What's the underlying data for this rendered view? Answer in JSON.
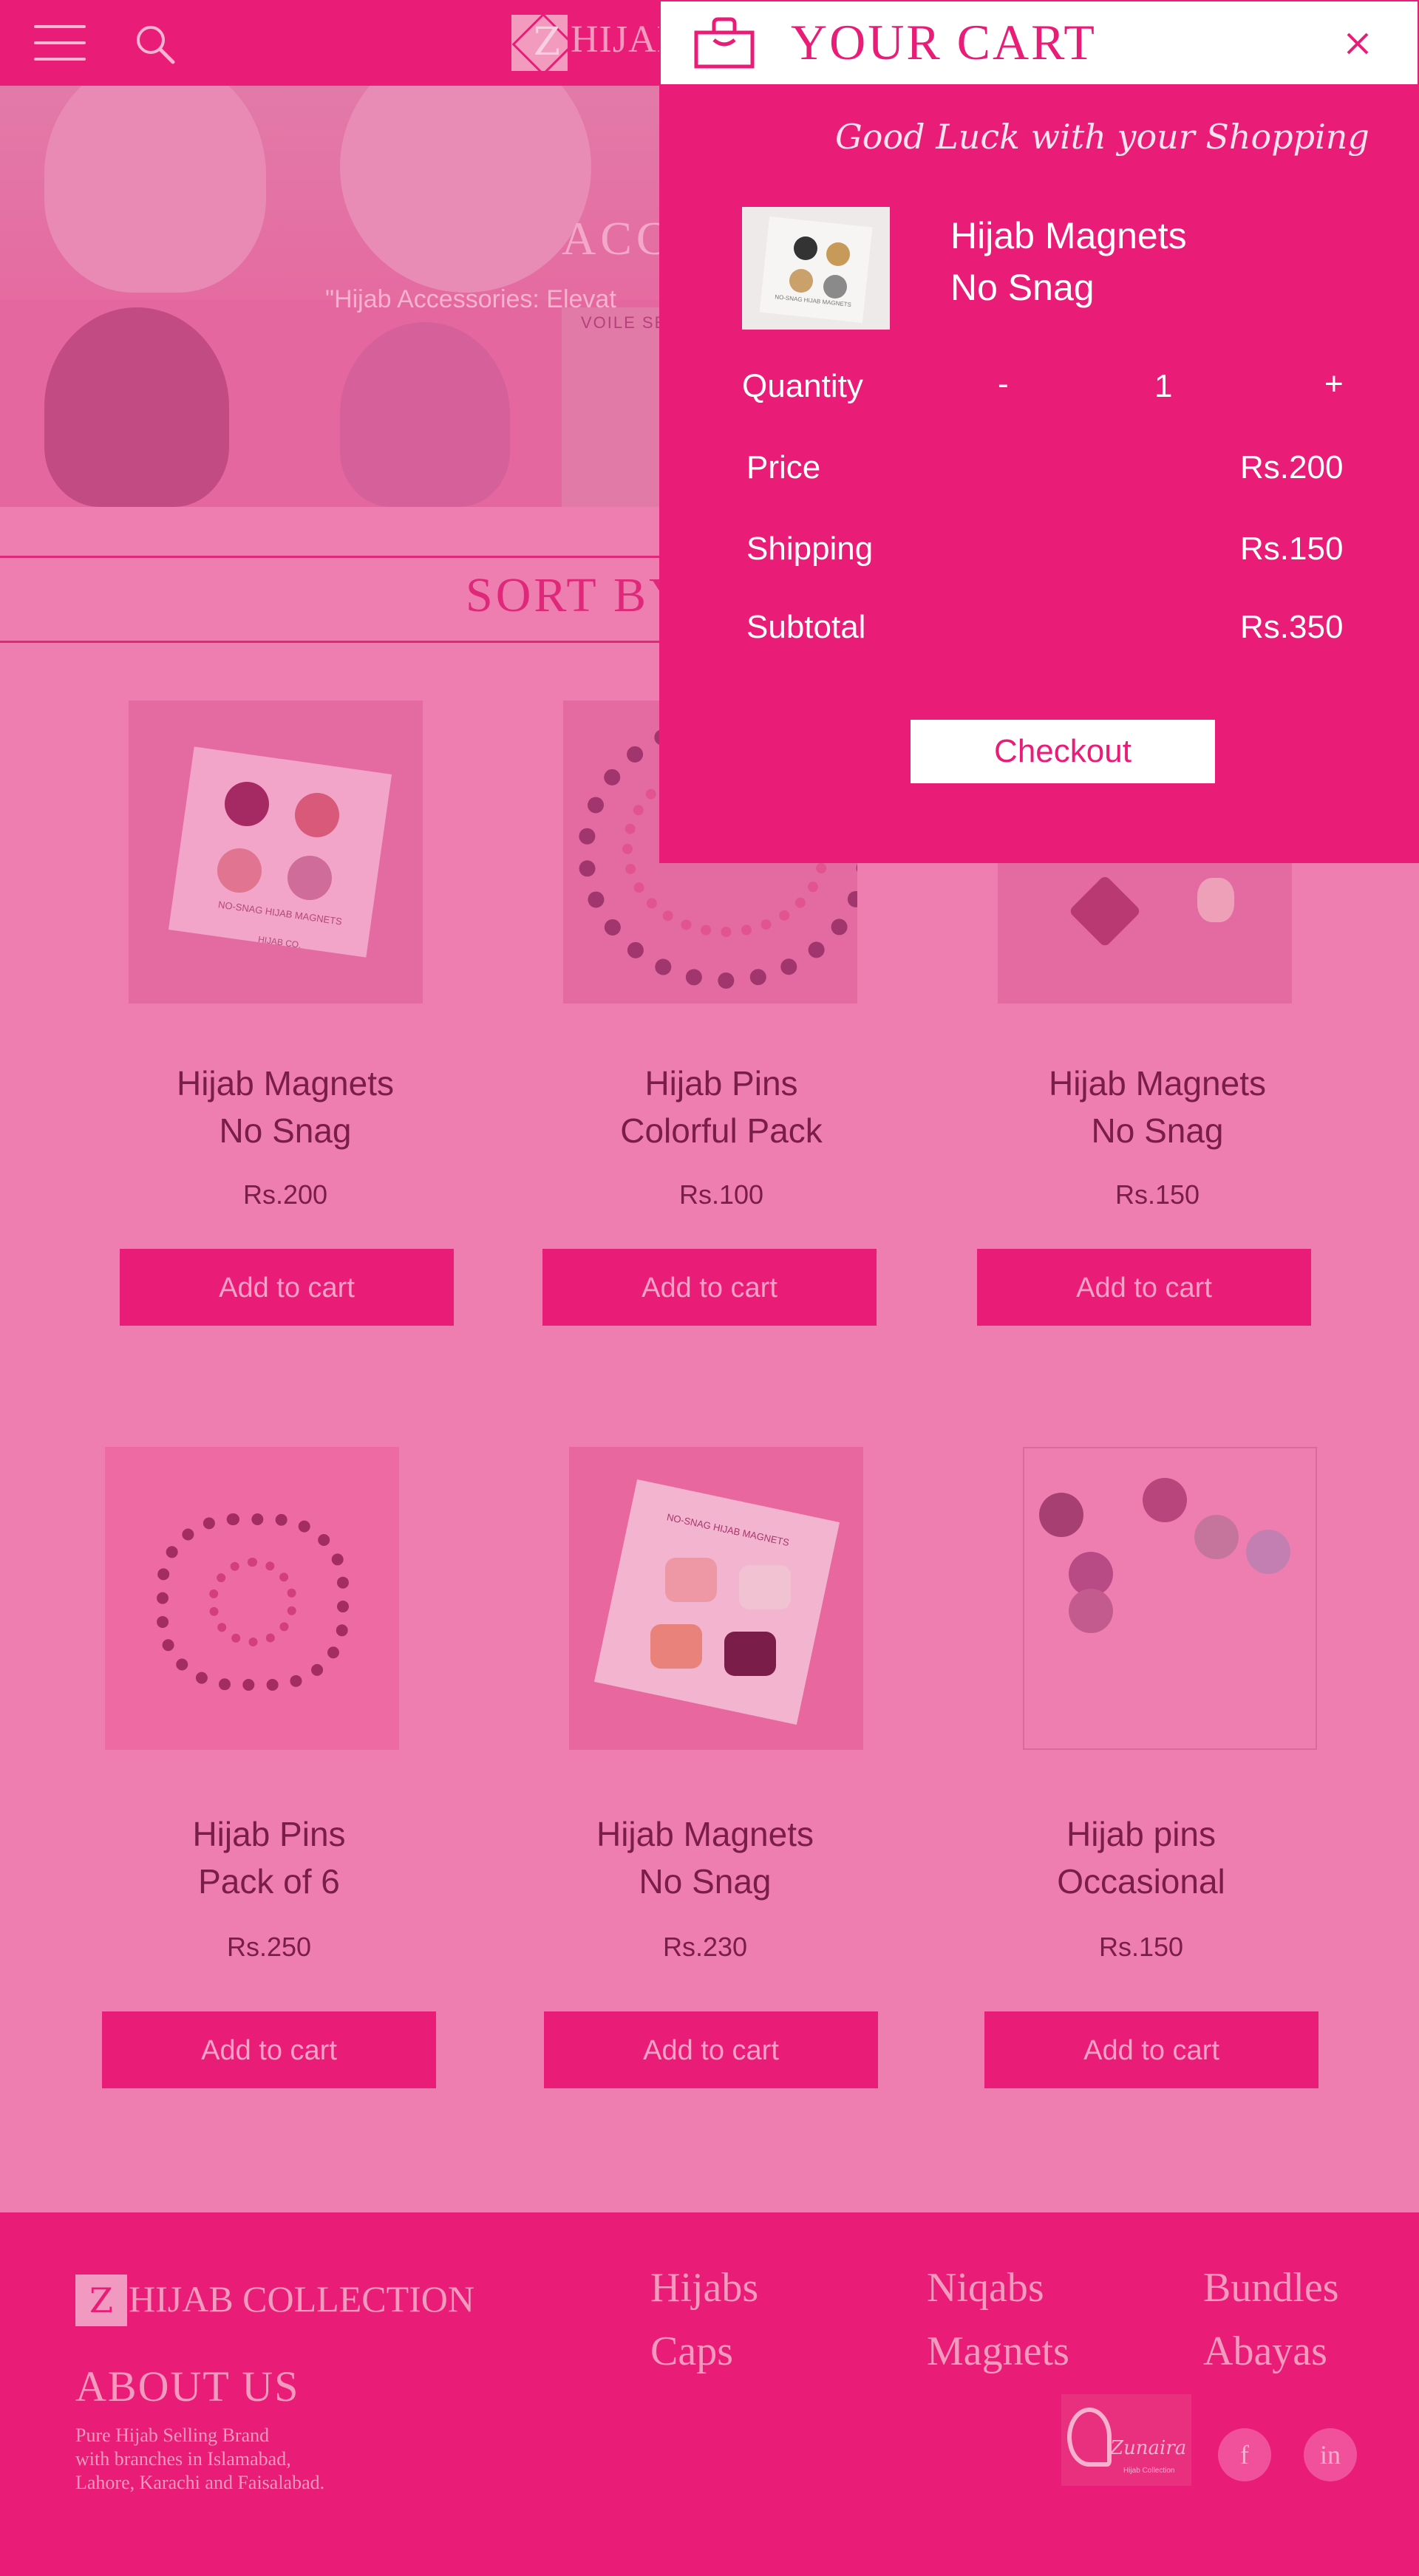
{
  "header": {
    "logo_letter": "Z",
    "logo_text": "HIJAB"
  },
  "hero": {
    "title": "ACC",
    "quote": "\"Hijab Accessories: Elevat",
    "mini_label": "VOILE SE"
  },
  "sort": {
    "label": "SORT BY"
  },
  "products": [
    {
      "name1": "Hijab Magnets",
      "name2": "No Snag",
      "price": "Rs.200",
      "button": "Add to cart"
    },
    {
      "name1": "Hijab Pins",
      "name2": "Colorful Pack",
      "price": "Rs.100",
      "button": "Add to cart"
    },
    {
      "name1": "Hijab Magnets",
      "name2": "No Snag",
      "price": "Rs.150",
      "button": "Add to cart"
    },
    {
      "name1": "Hijab Pins",
      "name2": "Pack of 6",
      "price": "Rs.250",
      "button": "Add to cart"
    },
    {
      "name1": "Hijab Magnets",
      "name2": "No Snag",
      "price": "Rs.230",
      "button": "Add to cart"
    },
    {
      "name1": "Hijab pins",
      "name2": "Occasional",
      "price": "Rs.150",
      "button": "Add to cart"
    }
  ],
  "product_image_labels": {
    "magnets_card": "NO-SNAG HIJAB MAGNETS",
    "magnets_brand": "HIJAB CO.",
    "magnets_card2": "NO-SNAG HIJAB MAGNETS"
  },
  "cart": {
    "title": "YOUR CART",
    "greeting": "Good Luck with your Shopping",
    "item_name1": "Hijab Magnets",
    "item_name2": "No Snag",
    "thumb_label": "NO-SNAG HIJAB MAGNETS",
    "quantity_label": "Quantity",
    "minus": "-",
    "quantity": "1",
    "plus": "+",
    "price_label": "Price",
    "price": "Rs.200",
    "shipping_label": "Shipping",
    "shipping": "Rs.150",
    "subtotal_label": "Subtotal",
    "subtotal": "Rs.350",
    "checkout": "Checkout"
  },
  "footer": {
    "logo_letter": "Z",
    "logo_text": "HIJAB COLLECTION",
    "about_title": "ABOUT US",
    "about_line1": "Pure Hijab Selling Brand",
    "about_line2": "with branches in Islamabad,",
    "about_line3": "Lahore, Karachi and Faisalabad.",
    "links": [
      "Hijabs",
      "Niqabs",
      "Bundles",
      "Caps",
      "Magnets",
      "Abayas"
    ],
    "brand_name": "Zunaira",
    "brand_sub": "Hijab Collection",
    "social_f": "f",
    "social_in": "in"
  },
  "colors": {
    "brand": "#e91c78",
    "page_bg": "#ee7eb0",
    "text_dark": "#7a1d49"
  }
}
